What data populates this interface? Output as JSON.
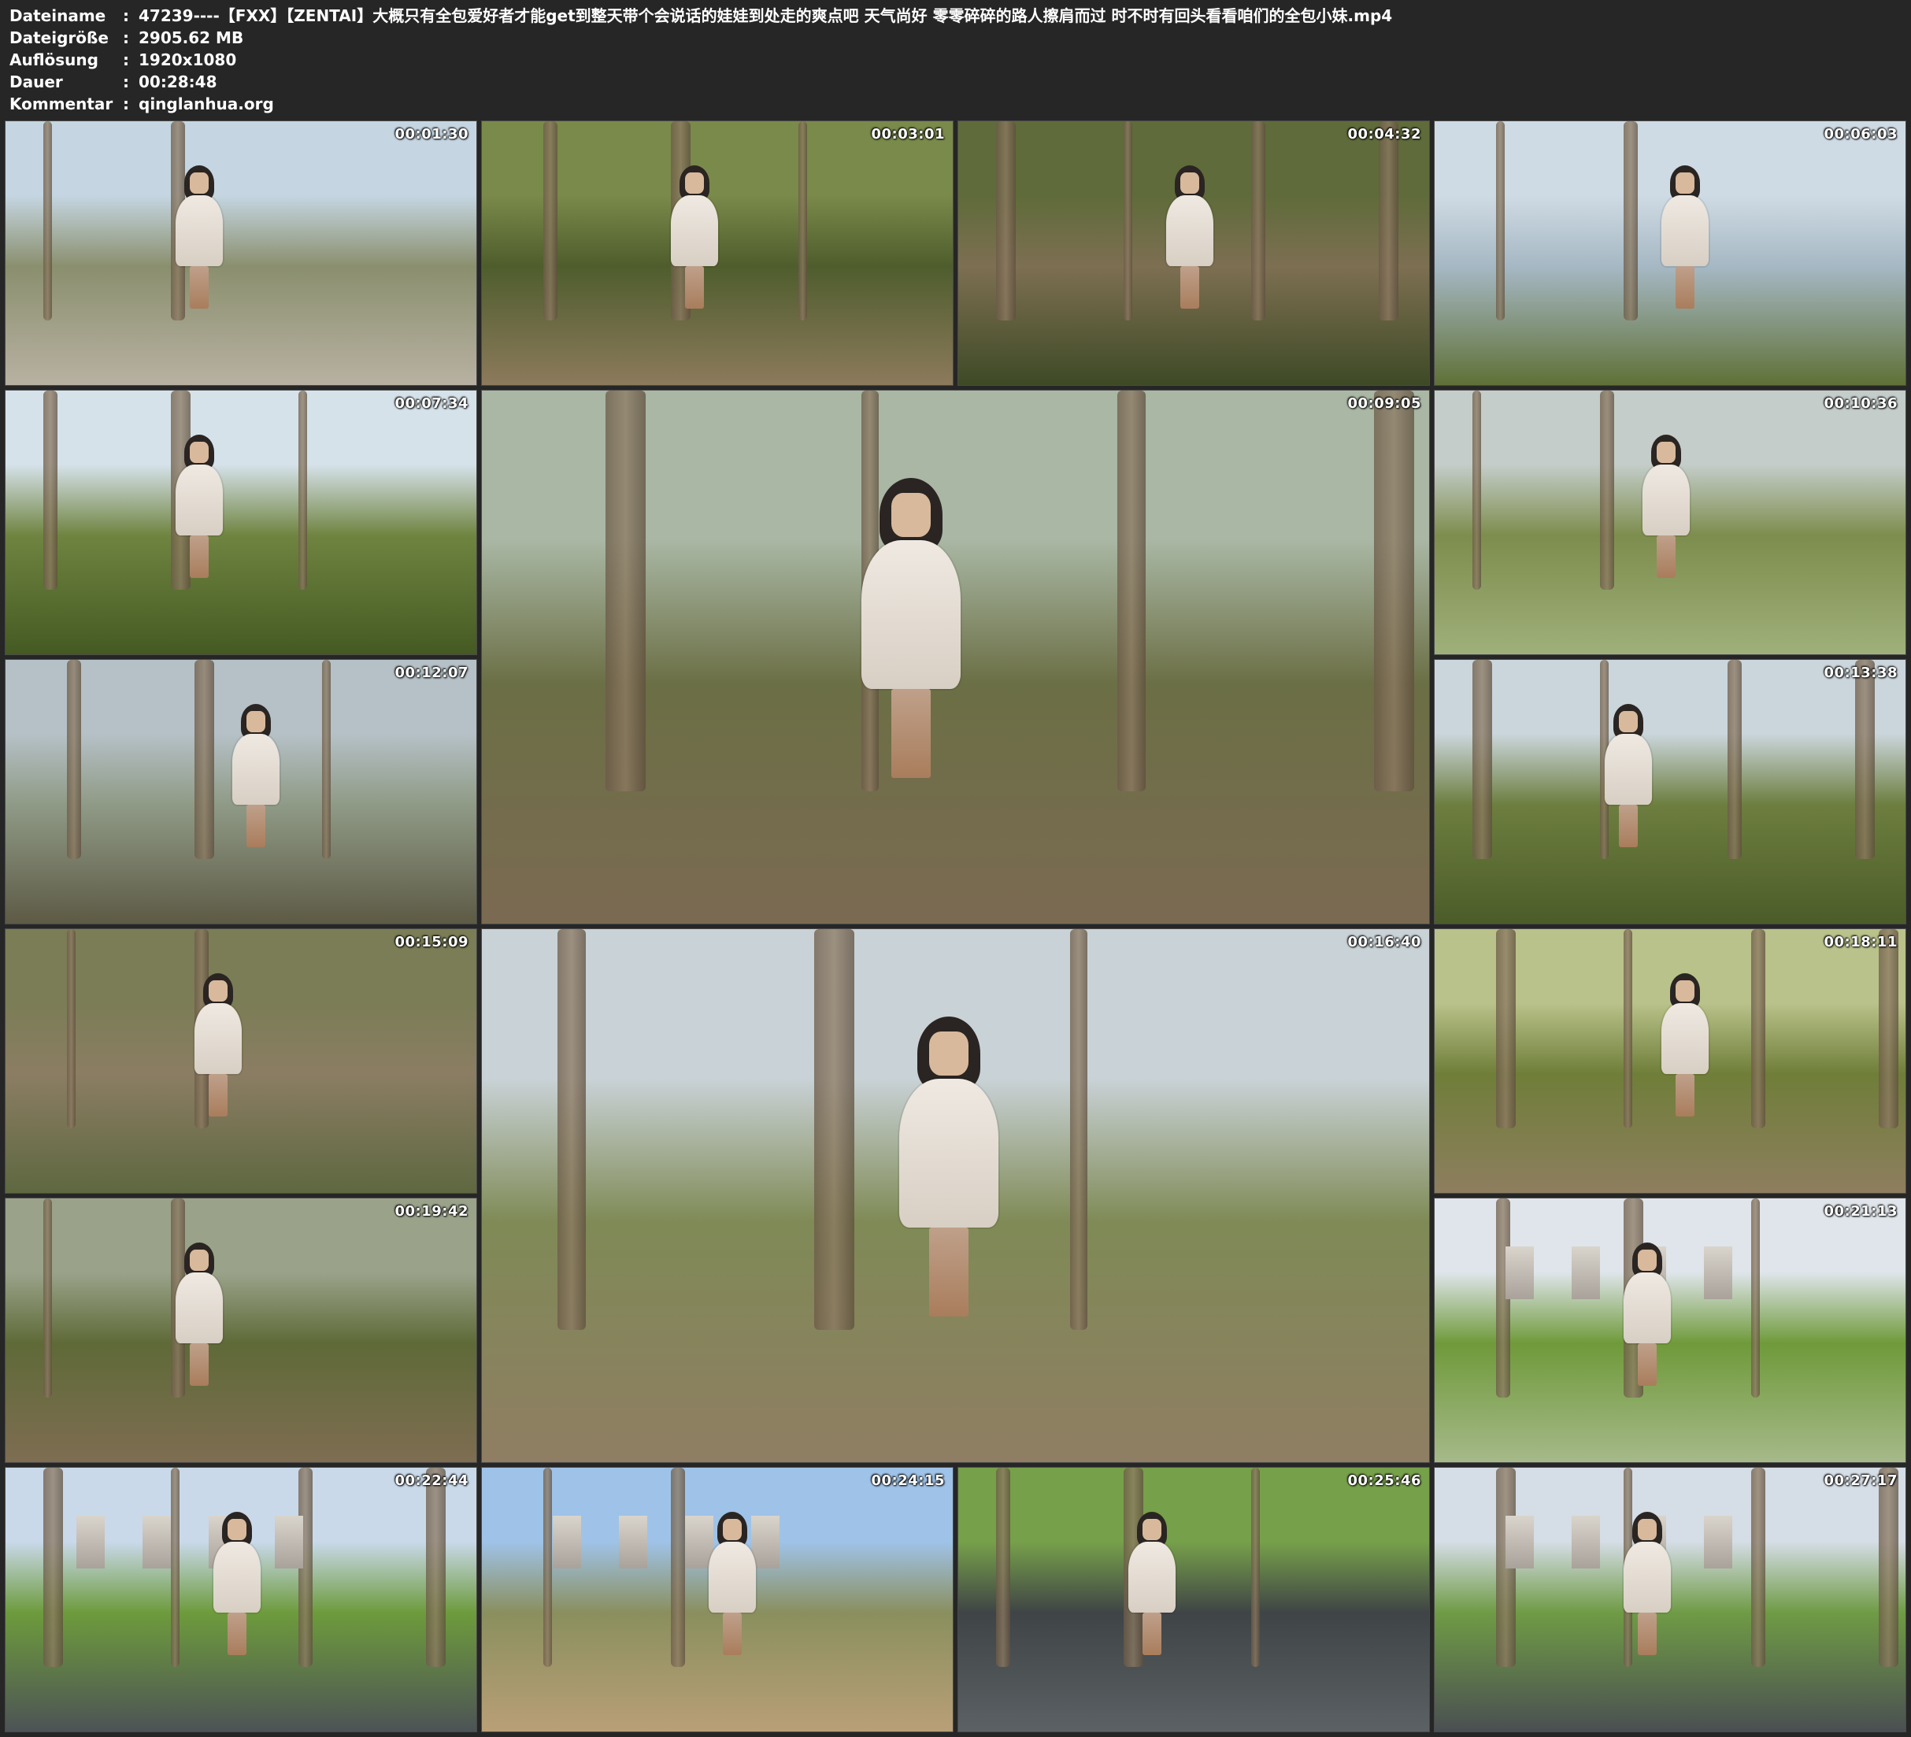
{
  "header": {
    "rows": [
      {
        "label": "Dateiname",
        "colon": ":",
        "value": "47239----【FXX】【ZENTAI】大概只有全包爱好者才能get到整天带个会说话的娃娃到处走的爽点吧 天气尚好 零零碎碎的路人擦肩而过 时不时有回头看看咱们的全包小妹.mp4"
      },
      {
        "label": "Dateigröße",
        "colon": ":",
        "value": "2905.62 MB"
      },
      {
        "label": "Auflösung",
        "colon": ":",
        "value": "1920x1080"
      },
      {
        "label": "Dauer",
        "colon": ":",
        "value": "00:28:48"
      },
      {
        "label": "Kommentar",
        "colon": ":",
        "value": "qinglanhua.org"
      }
    ]
  },
  "thumbnails": [
    {
      "timestamp": "00:01:30",
      "scene": "stone-path-reeds"
    },
    {
      "timestamp": "00:03:01",
      "scene": "woods-tree-lean"
    },
    {
      "timestamp": "00:04:32",
      "scene": "woods-closeup"
    },
    {
      "timestamp": "00:06:03",
      "scene": "lakeside-back"
    },
    {
      "timestamp": "00:07:34",
      "scene": "lakeside-trees"
    },
    {
      "timestamp": "00:09:05",
      "scene": "forest-closeup-large"
    },
    {
      "timestamp": "00:10:36",
      "scene": "lake-profile"
    },
    {
      "timestamp": "00:12:07",
      "scene": "lake-hair-closeup"
    },
    {
      "timestamp": "00:13:38",
      "scene": "forest-walk"
    },
    {
      "timestamp": "00:15:09",
      "scene": "forest-hand"
    },
    {
      "timestamp": "00:16:40",
      "scene": "forest-peek-large"
    },
    {
      "timestamp": "00:18:11",
      "scene": "path-sunlight"
    },
    {
      "timestamp": "00:19:42",
      "scene": "thicket-stand"
    },
    {
      "timestamp": "00:21:13",
      "scene": "park-lawn"
    },
    {
      "timestamp": "00:22:44",
      "scene": "park-path-city"
    },
    {
      "timestamp": "00:24:15",
      "scene": "field-city"
    },
    {
      "timestamp": "00:25:46",
      "scene": "road-sit"
    },
    {
      "timestamp": "00:27:17",
      "scene": "road-lie"
    }
  ]
}
